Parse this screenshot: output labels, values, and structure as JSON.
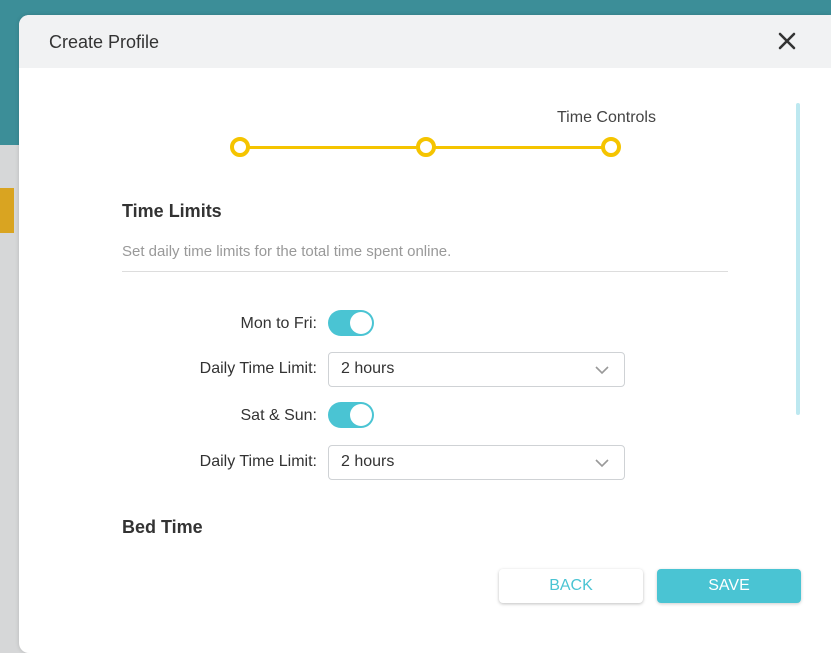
{
  "dialog": {
    "title": "Create Profile"
  },
  "stepper": {
    "current_step_label": "Time Controls"
  },
  "time_limits": {
    "title": "Time Limits",
    "description": "Set daily time limits for the total time spent online.",
    "weekday": {
      "label": "Mon to Fri:",
      "enabled": true
    },
    "weekday_limit": {
      "label": "Daily Time Limit:",
      "value": "2 hours"
    },
    "weekend": {
      "label": "Sat & Sun:",
      "enabled": true
    },
    "weekend_limit": {
      "label": "Daily Time Limit:",
      "value": "2 hours"
    }
  },
  "bed_time": {
    "title": "Bed Time"
  },
  "footer": {
    "back_label": "BACK",
    "save_label": "SAVE"
  },
  "colors": {
    "accent": "#4ac4d3",
    "stepper": "#f5c400"
  },
  "icons": {
    "close": "close-icon",
    "dropdown": "chevron-down-icon"
  }
}
